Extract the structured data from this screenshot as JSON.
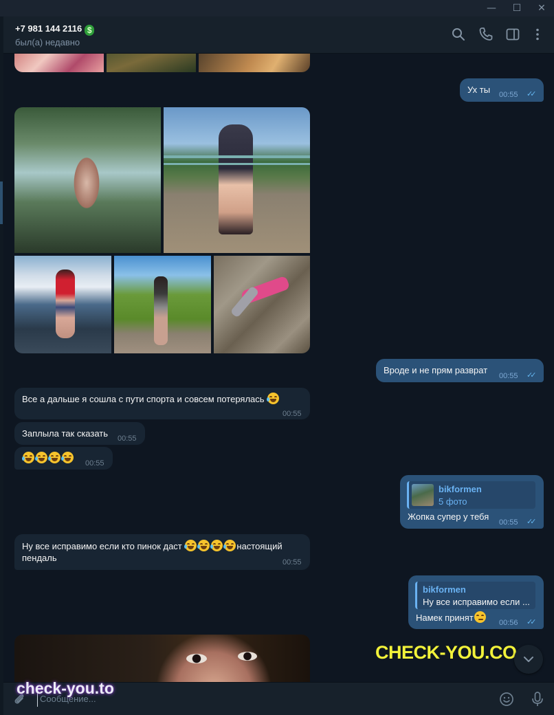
{
  "window": {
    "minimize": "—",
    "maximize": "☐",
    "close": "✕"
  },
  "header": {
    "peer_name": "+7 981 144 2116",
    "peer_badge": "$",
    "status": "был(а) недавно",
    "icons": [
      "search-icon",
      "phone-icon",
      "sidebar-toggle-icon",
      "more-vertical-icon"
    ]
  },
  "messages": [
    {
      "id": "m1",
      "direction": "out",
      "text": "Ух ты",
      "time": "00:55",
      "read": "✓✓"
    },
    {
      "id": "m2",
      "direction": "in",
      "type": "album",
      "photos": 5
    },
    {
      "id": "m3",
      "direction": "out",
      "text": "Вроде и не прям разврат",
      "time": "00:55",
      "read": "✓✓"
    },
    {
      "id": "m4",
      "direction": "in",
      "text": "Все а дальше я сошла с пути спорта и совсем потерялась",
      "emoji_count": 1,
      "time": "00:55"
    },
    {
      "id": "m5",
      "direction": "in",
      "text": "Заплыла так сказать",
      "time": "00:55"
    },
    {
      "id": "m6",
      "direction": "in",
      "text": "",
      "emoji_count": 4,
      "time": "00:55"
    },
    {
      "id": "m7",
      "direction": "out",
      "reply_name": "bikformen",
      "reply_sub": "5 фото",
      "text": "Жопка супер у тебя",
      "time": "00:55",
      "read": "✓✓"
    },
    {
      "id": "m8",
      "direction": "in",
      "text_before": "Ну все исправимо если кто пинок даст",
      "emoji_count": 4,
      "text_after": "настоящий",
      "text_line2": "пендаль",
      "time": "00:55"
    },
    {
      "id": "m9",
      "direction": "out",
      "reply_name": "bikformen",
      "reply_text": "Ну все исправимо если ...",
      "text": "Намек принят",
      "emoji_count": 1,
      "time": "00:56",
      "read": "✓✓"
    }
  ],
  "watermarks": {
    "big": "CHECK-YOU.CO",
    "small": "check-you.to"
  },
  "composer": {
    "placeholder": "Сообщение...",
    "icons": [
      "attach-icon",
      "emoji-icon",
      "microphone-icon"
    ]
  },
  "colors": {
    "background": "#0e1621",
    "header": "#17212b",
    "incoming": "#182533",
    "outgoing": "#2b5278",
    "accent": "#6ab2f2",
    "watermark_yellow": "#f2f23a"
  }
}
